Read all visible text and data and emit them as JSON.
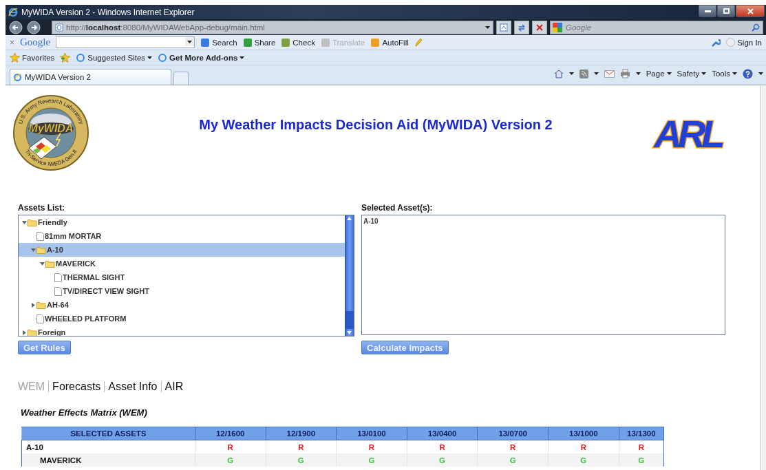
{
  "window": {
    "title": "MyWIDA Version 2 - Windows Internet Explorer"
  },
  "address_bar": {
    "url_prefix": "http://",
    "url_host": "localhost",
    "url_rest": ":8080/MyWIDAWebApp-debug/main.html"
  },
  "search_box": {
    "placeholder": "Google"
  },
  "google_toolbar": {
    "close": "×",
    "brand": "Google",
    "items": [
      {
        "label": "Search",
        "disabled": false
      },
      {
        "label": "Share",
        "disabled": false
      },
      {
        "label": "Check",
        "disabled": false
      },
      {
        "label": "Translate",
        "disabled": true
      },
      {
        "label": "AutoFill",
        "disabled": false
      }
    ],
    "sign_in": "Sign In"
  },
  "favorites_bar": {
    "favorites": "Favorites",
    "links": [
      {
        "label": "Suggested Sites",
        "bold": false
      },
      {
        "label": "Get More Add-ons",
        "bold": true
      }
    ]
  },
  "tabs": [
    {
      "label": "MyWIDA Version 2",
      "selected": true
    }
  ],
  "command_bar": [
    "Page",
    "Safety",
    "Tools"
  ],
  "page": {
    "title": "My Weather Impacts Decision Aid (MyWIDA) Version 2",
    "logo": {
      "ring_top": "U.S. Army Research Laboratory",
      "name": "MyWIDA",
      "ring_bottom": "Tri-Service IWEDA Gen.II"
    },
    "arl_logo": "ARL",
    "assets_label": "Assets List:",
    "tree": [
      {
        "label": "Friendly",
        "kind": "folder",
        "expanded": true,
        "selected": false,
        "children": [
          {
            "label": "81mm MORTAR",
            "kind": "file",
            "selected": false
          },
          {
            "label": "A-10",
            "kind": "folder",
            "expanded": true,
            "selected": true,
            "children": [
              {
                "label": "MAVERICK",
                "kind": "folder",
                "expanded": true,
                "selected": false,
                "children": [
                  {
                    "label": "THERMAL SIGHT",
                    "kind": "file",
                    "selected": false
                  },
                  {
                    "label": "TV/DIRECT VIEW SIGHT",
                    "kind": "file",
                    "selected": false
                  }
                ]
              }
            ]
          },
          {
            "label": "AH-64",
            "kind": "folder",
            "expanded": false,
            "selected": false
          },
          {
            "label": "WHEELED PLATFORM",
            "kind": "file",
            "selected": false
          }
        ]
      },
      {
        "label": "Foreign",
        "kind": "folder",
        "expanded": false,
        "selected": false
      }
    ],
    "selected_label": "Selected Asset(s):",
    "selected_assets": [
      "A-10"
    ],
    "buttons": {
      "get_rules": "Get Rules",
      "calculate": "Calculate Impacts"
    },
    "view_tabs": [
      {
        "label": "WEM",
        "selected": true
      },
      {
        "label": "Forecasts",
        "selected": false
      },
      {
        "label": "Asset Info",
        "selected": false
      },
      {
        "label": "AIR",
        "selected": false
      }
    ],
    "matrix_title": "Weather Effects Matrix (WEM)",
    "matrix": {
      "columns": [
        "SELECTED ASSETS",
        "12/1600",
        "12/1900",
        "13/0100",
        "13/0400",
        "13/0700",
        "13/1000",
        "13/1300"
      ],
      "rows": [
        {
          "child": false,
          "cells": [
            {
              "text": "A-10",
              "kind": "name"
            },
            {
              "text": "R",
              "color": "#e8141c"
            },
            {
              "text": "R",
              "color": "#e8141c"
            },
            {
              "text": "R",
              "color": "#e8141c"
            },
            {
              "text": "R",
              "color": "#e8141c"
            },
            {
              "text": "R",
              "color": "#e8141c"
            },
            {
              "text": "R",
              "color": "#e8141c"
            },
            {
              "text": "R",
              "color": "#e8141c"
            }
          ]
        },
        {
          "child": true,
          "cells": [
            {
              "text": "MAVERICK",
              "kind": "name"
            },
            {
              "text": "G",
              "color": "#3cc83c"
            },
            {
              "text": "G",
              "color": "#3cc83c"
            },
            {
              "text": "G",
              "color": "#3cc83c"
            },
            {
              "text": "G",
              "color": "#3cc83c"
            },
            {
              "text": "G",
              "color": "#3cc83c"
            },
            {
              "text": "G",
              "color": "#3cc83c"
            },
            {
              "text": "G",
              "color": "#3cc83c"
            }
          ]
        }
      ]
    }
  }
}
